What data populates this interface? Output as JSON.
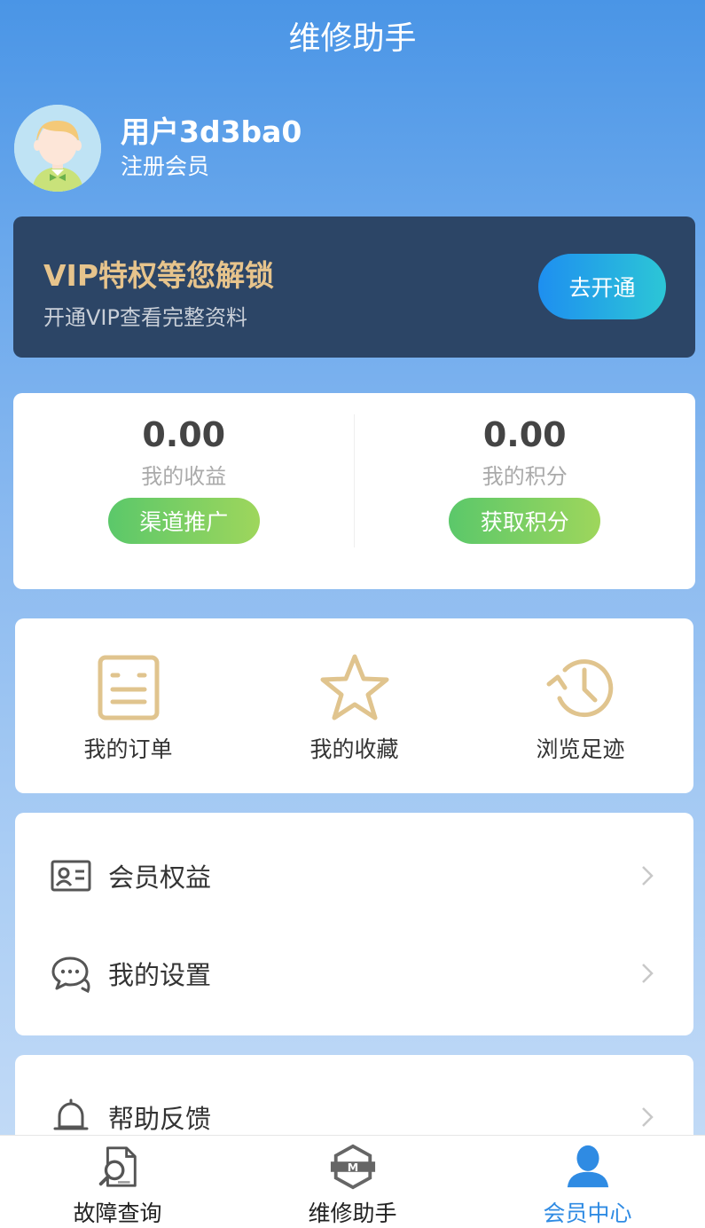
{
  "header": {
    "title": "维修助手"
  },
  "profile": {
    "name": "用户3d3ba0",
    "level": "注册会员"
  },
  "vip": {
    "title": "VIP特权等您解锁",
    "subtitle": "开通VIP查看完整资料",
    "button": "去开通"
  },
  "stats": [
    {
      "value": "0.00",
      "label": "我的收益",
      "button": "渠道推广"
    },
    {
      "value": "0.00",
      "label": "我的积分",
      "button": "获取积分"
    }
  ],
  "quick": [
    {
      "label": "我的订单",
      "icon": "order-icon"
    },
    {
      "label": "我的收藏",
      "icon": "star-icon"
    },
    {
      "label": "浏览足迹",
      "icon": "history-icon"
    }
  ],
  "menu": [
    {
      "label": "会员权益",
      "icon": "id-card-icon"
    },
    {
      "label": "我的设置",
      "icon": "chat-icon"
    },
    {
      "label": "帮助反馈",
      "icon": "bell-icon"
    }
  ],
  "tabs": [
    {
      "label": "故障查询",
      "icon": "fault-search-icon",
      "active": false
    },
    {
      "label": "维修助手",
      "icon": "repair-logo-icon",
      "active": false
    },
    {
      "label": "会员中心",
      "icon": "user-icon",
      "active": true
    }
  ],
  "colors": {
    "accent": "#2f8be3",
    "gold": "#e7c48c",
    "vip_bg": "#2c4566",
    "green": "#5bc86a"
  }
}
